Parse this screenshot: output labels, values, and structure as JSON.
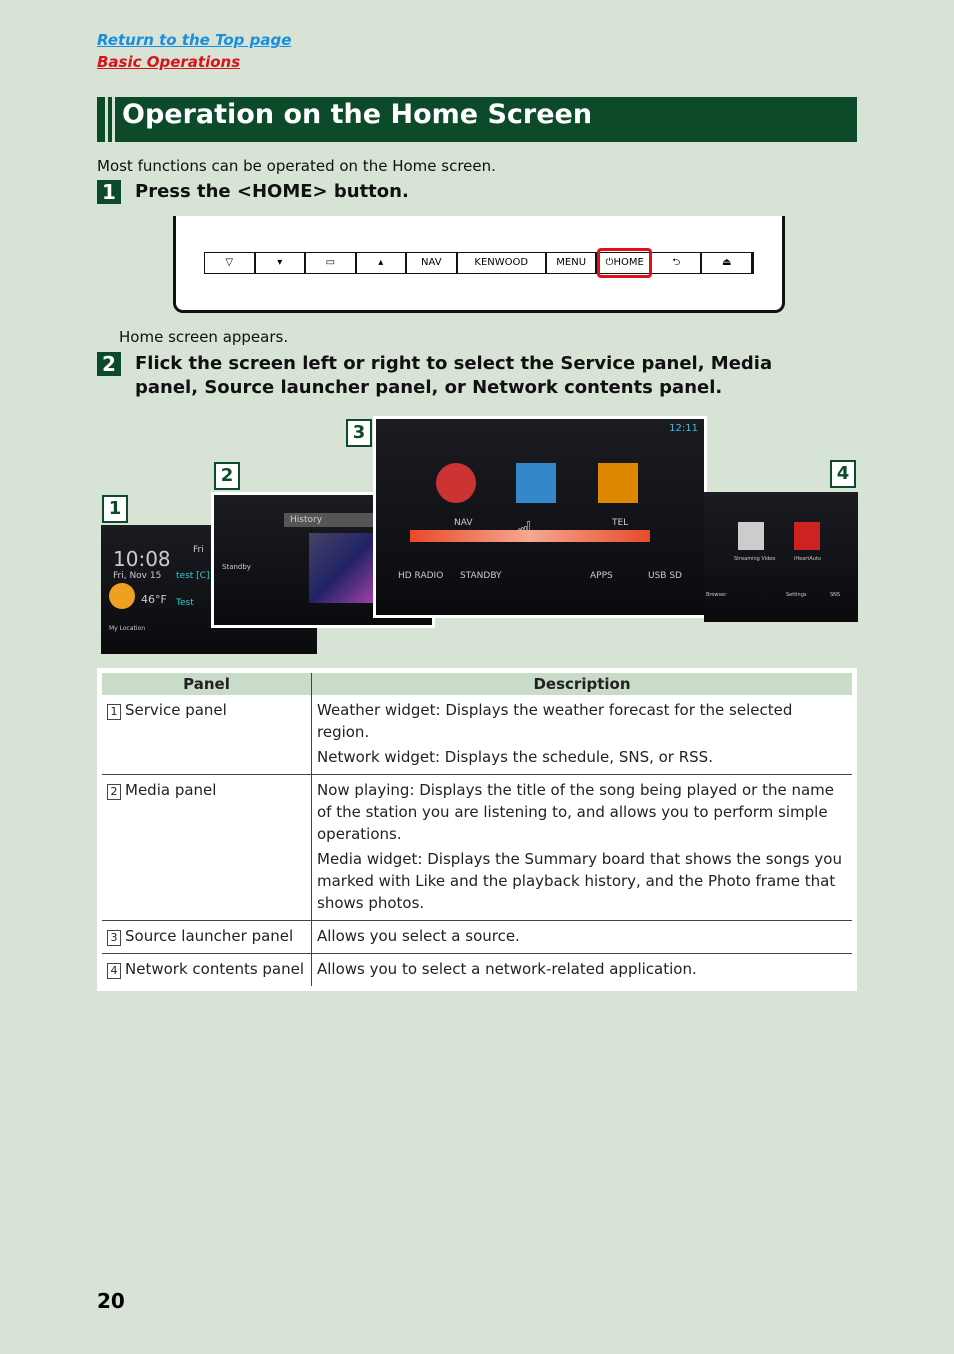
{
  "links": {
    "top": "Return to the Top page",
    "section": "Basic Operations"
  },
  "title": "Operation on the Home Screen",
  "intro": "Most functions can be operated on the Home screen.",
  "steps": [
    {
      "num": "1",
      "text": "Press the <HOME> button."
    },
    {
      "num": "2",
      "text": "Flick the screen left or right to select the Service panel, Media panel, Source launcher panel, or Network contents panel."
    }
  ],
  "device_buttons": [
    "▽",
    "▾",
    "▭",
    "▴",
    "NAV",
    "KENWOOD",
    "MENU",
    "⏻HOME",
    "⮌",
    "⏏"
  ],
  "home_appears": "Home screen appears.",
  "screens": {
    "s1": {
      "num": "1",
      "time": "10:08",
      "date": "Fri, Nov 15",
      "temp": "46°F",
      "loc": "My Location",
      "day": "Fri",
      "ev1": "test [C]",
      "ev2": "Test"
    },
    "s2": {
      "num": "2",
      "standby": "Standby",
      "history": "History"
    },
    "s3": {
      "num": "3",
      "clock": "12:11",
      "icons": [
        "NAV",
        "TEL",
        "HD RADIO",
        "STANDBY",
        "APPS",
        "USB SD"
      ]
    },
    "s4": {
      "num": "4",
      "icons": [
        "Streaming Video",
        "iHeartAuto",
        "Browser",
        "Settings",
        "SNS"
      ]
    }
  },
  "table": {
    "headers": [
      "Panel",
      "Description"
    ],
    "rows": [
      {
        "n": "1",
        "panel": "Service panel",
        "desc": [
          "Weather widget: Displays the weather forecast for the selected region.",
          "Network widget: Displays the schedule, SNS, or RSS."
        ]
      },
      {
        "n": "2",
        "panel": "Media panel",
        "desc": [
          "Now playing: Displays the title of the song being played or the name of the station you are listening to, and allows you to perform simple operations.",
          "Media widget: Displays the Summary board that shows the songs you marked with Like and the playback history, and the Photo frame that shows photos."
        ]
      },
      {
        "n": "3",
        "panel": "Source launcher panel",
        "desc": [
          "Allows you select a source."
        ]
      },
      {
        "n": "4",
        "panel": "Network contents panel",
        "desc": [
          "Allows you to select a network-related application."
        ]
      }
    ]
  },
  "page_number": "20"
}
